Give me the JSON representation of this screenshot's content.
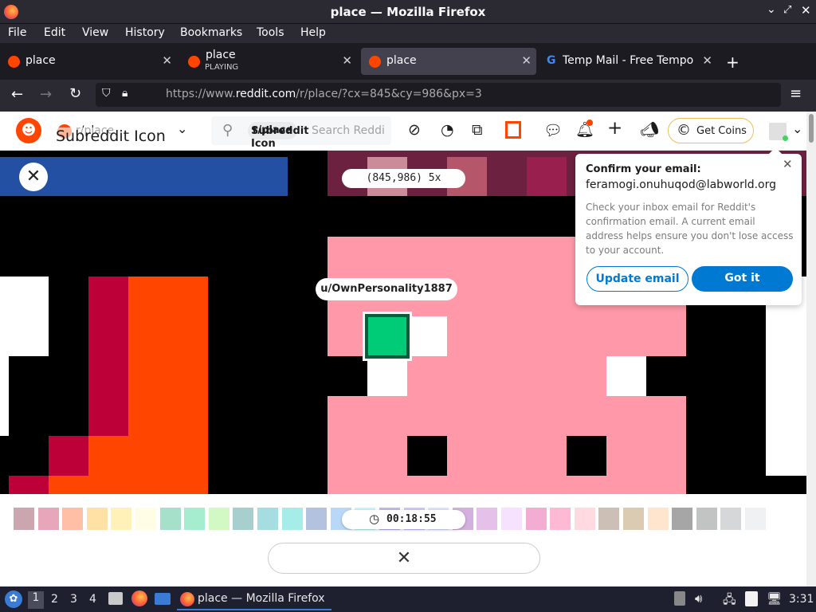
{
  "window": {
    "title": "place — Mozilla Firefox"
  },
  "menu": {
    "items": [
      "File",
      "Edit",
      "View",
      "History",
      "Bookmarks",
      "Tools",
      "Help"
    ]
  },
  "tabs": [
    {
      "label": "place",
      "sub": ""
    },
    {
      "label": "place",
      "sub": "PLAYING"
    },
    {
      "label": "place",
      "sub": ""
    },
    {
      "label": "Temp Mail - Free Tempora",
      "sub": ""
    }
  ],
  "nav": {
    "url_prefix": "https://www.",
    "url_domain": "reddit.com",
    "url_path": "/r/place/?cx=845&cy=986&px=3"
  },
  "reddit": {
    "subreddit_alt": "Subreddit Icon",
    "subreddit_name": "r/place",
    "search_chip_alt": "Subreddit Icon",
    "search_chip_text": "r/place",
    "search_placeholder": "Search Reddit",
    "get_coins": "Get Coins"
  },
  "place": {
    "coords": "(845,986) 5x",
    "username": "u/OwnPersonality1887",
    "timer": "00:18:55"
  },
  "popup": {
    "title": "Confirm your email:",
    "email": "feramogi.onuhuqod@labworld.org",
    "body": "Check your inbox email for Reddit's confirmation email. A current email address helps ensure you don't lose access to your account.",
    "update": "Update email",
    "got_it": "Got it"
  },
  "colors": {
    "accent": "#0079d3",
    "reddit": "#ff4500",
    "pink": "#ff99aa",
    "selected": "#00cc78"
  },
  "palette": [
    "#6d001a",
    "#be0039",
    "#ff4500",
    "#ffa800",
    "#ffd635",
    "#fff8b8",
    "#00a368",
    "#00cc78",
    "#7eed56",
    "#00756f",
    "#009eaa",
    "#00ccc0",
    "#2450a4",
    "#3690ea",
    "#51e9f4",
    "#493ac1",
    "#6a5cff",
    "#94b3ff",
    "#811e9f",
    "#b44ac0",
    "#e4abff",
    "#de107f",
    "#ff3881",
    "#ff99aa",
    "#6d482f",
    "#9c6926",
    "#ffb470",
    "#000000",
    "#515252",
    "#898d90",
    "#d4d7d9",
    "#ffffff"
  ],
  "taskbar": {
    "workspaces": [
      "1",
      "2",
      "3",
      "4"
    ],
    "active_window": "place — Mozilla Firefox",
    "clock": "3:31"
  }
}
